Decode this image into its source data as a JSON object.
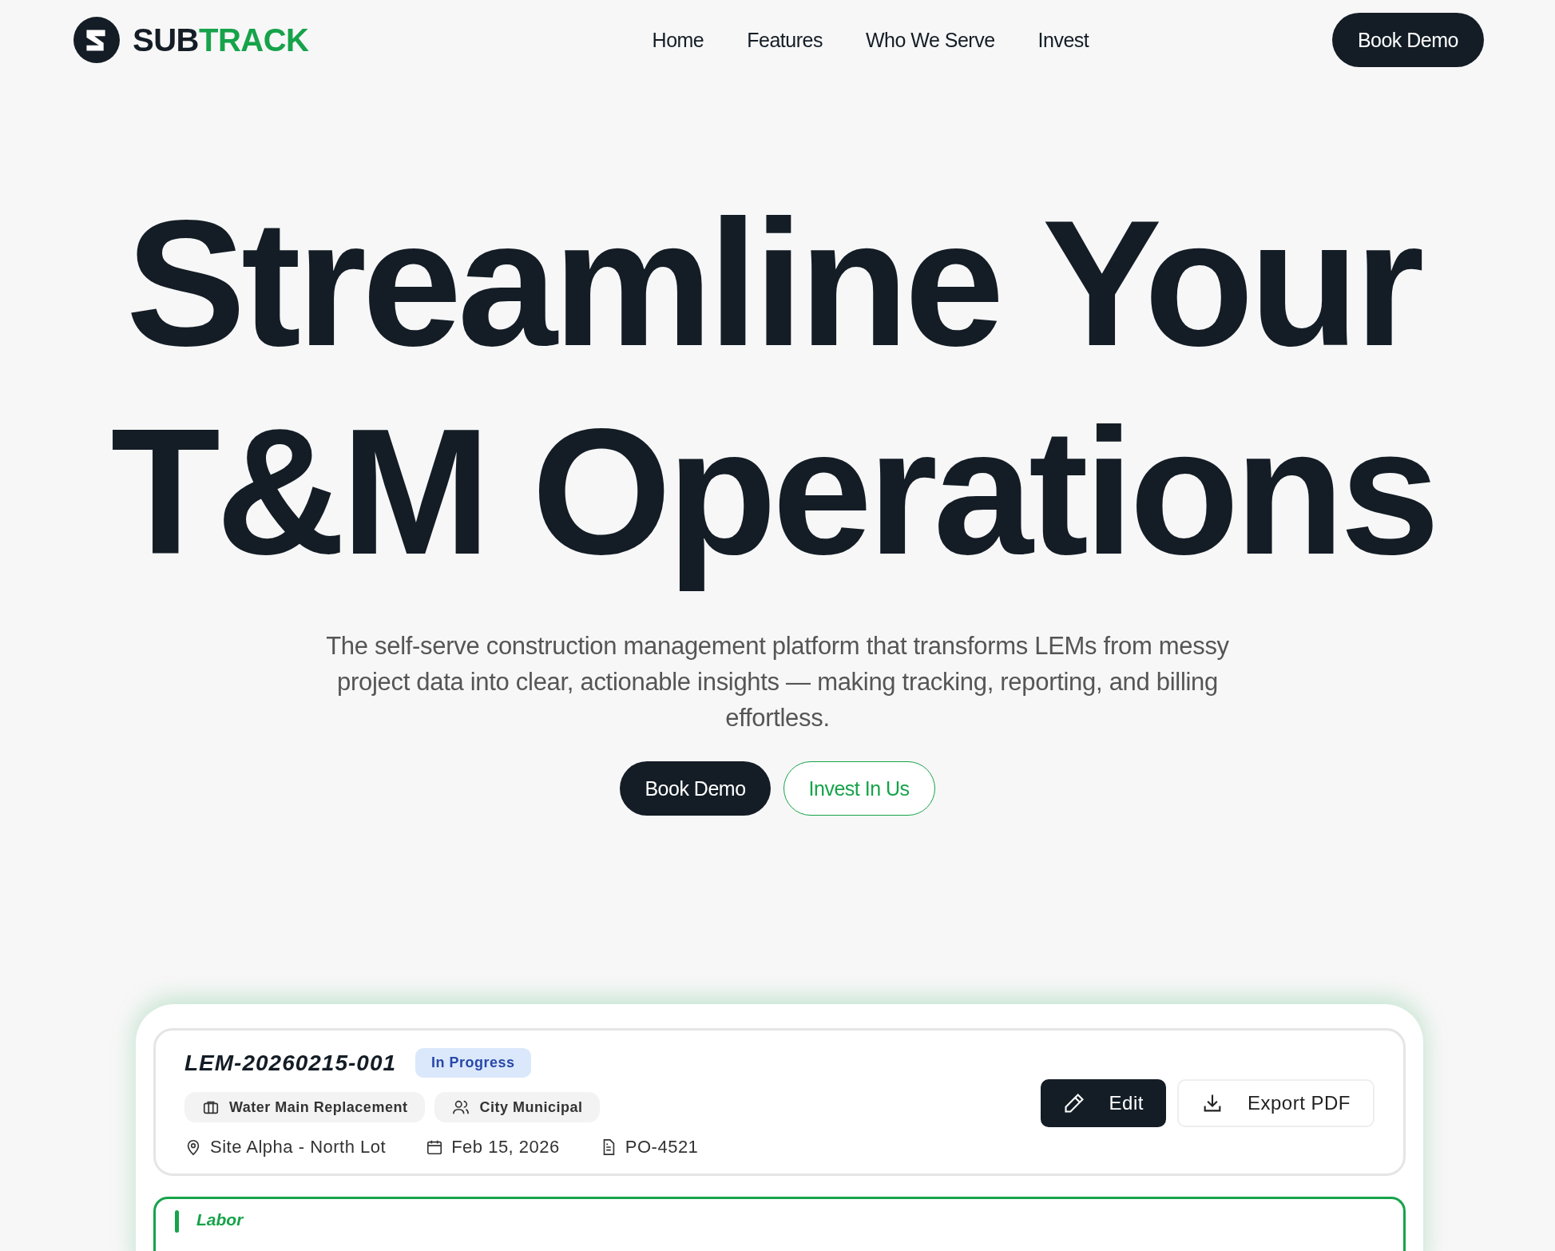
{
  "brand": {
    "name_dark": "SUB",
    "name_accent": "TRACK"
  },
  "nav": {
    "links": [
      "Home",
      "Features",
      "Who We Serve",
      "Invest"
    ],
    "cta": "Book Demo"
  },
  "hero": {
    "title_lines": [
      "Streamline Your",
      "T&M Operations"
    ],
    "subtitle": "The self-serve construction management platform that transforms LEMs from messy project data into clear, actionable insights — making tracking, reporting, and billing effortless.",
    "buttons": [
      {
        "label": "Book Demo",
        "kind": "primary"
      },
      {
        "label": "Invest In Us",
        "kind": "outline"
      }
    ]
  },
  "lem": {
    "id": "LEM-20260215-001",
    "status": "In Progress",
    "tags": [
      {
        "label": "Water Main Replacement",
        "kind": "project"
      },
      {
        "label": "City Municipal",
        "kind": "client"
      }
    ],
    "meta": [
      {
        "label": "Site Alpha - North Lot",
        "kind": "location"
      },
      {
        "label": "Feb 15, 2026",
        "kind": "date"
      },
      {
        "label": "PO-4521",
        "kind": "document"
      }
    ],
    "actions": [
      {
        "label": "Edit",
        "kind": "edit"
      },
      {
        "label": "Export PDF",
        "kind": "export"
      }
    ],
    "section": "Labor"
  }
}
